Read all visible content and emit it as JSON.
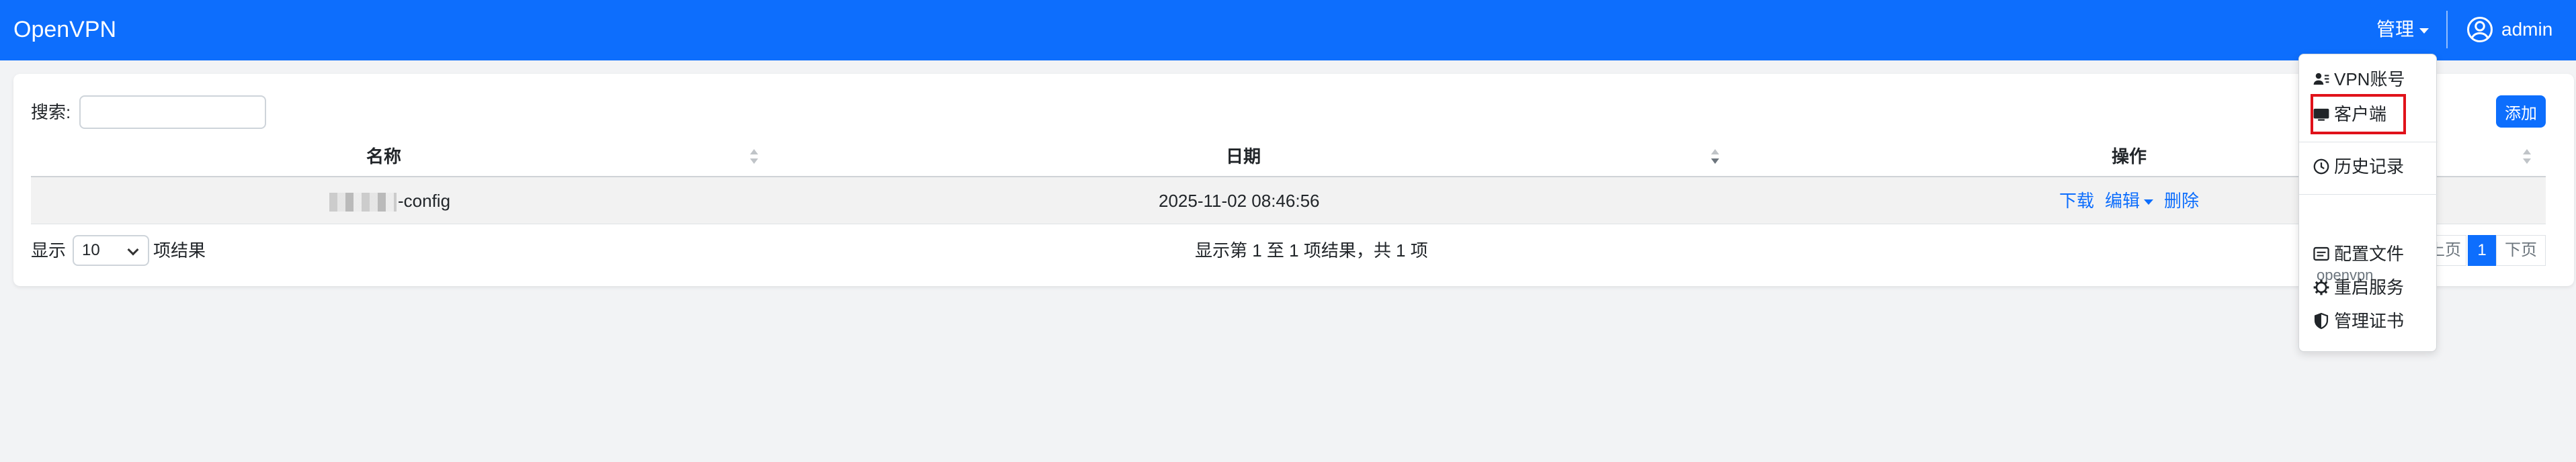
{
  "navbar": {
    "brand": "OpenVPN",
    "manage_label": "管理",
    "user_label": "admin"
  },
  "toolbar": {
    "search_label": "搜索:",
    "search_value": "",
    "add_label": "添加"
  },
  "table": {
    "columns": [
      "名称",
      "日期",
      "操作"
    ],
    "rows": [
      {
        "name": "-config",
        "date": "2025-11-02 08:46:56",
        "actions": [
          "下载",
          "编辑",
          "删除"
        ]
      }
    ]
  },
  "footer": {
    "show_label": "显示",
    "page_size": "10",
    "results_label": "项结果",
    "summary": "显示第 1 至 1 项结果，共 1 项",
    "pagination": {
      "prev": "上页",
      "current": "1",
      "next": "下页"
    }
  },
  "dropdown": {
    "items": [
      {
        "label": "VPN账号",
        "icon": "person-lines-icon"
      },
      {
        "label": "客户端",
        "icon": "monitor-icon"
      },
      {
        "label": "历史记录",
        "icon": "clock-history-icon"
      },
      {
        "label": "配置文件",
        "icon": "document-text-icon"
      },
      {
        "label": "重启服务",
        "icon": "gear-icon"
      },
      {
        "label": "管理证书",
        "icon": "shield-half-icon"
      }
    ],
    "section_header": "openvpn"
  },
  "colors": {
    "primary": "#0d6efd",
    "highlight": "#e0121a"
  }
}
